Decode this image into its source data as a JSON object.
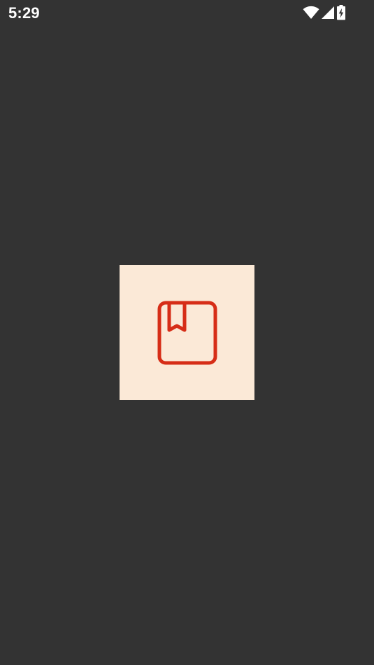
{
  "status_bar": {
    "time": "5:29",
    "icons": [
      "wifi-icon",
      "cell-signal-icon",
      "battery-charging-icon"
    ],
    "icon_color": "#ffffff"
  },
  "splash": {
    "background_color": "#fbe9d7",
    "icon": "book-bookmark-icon",
    "icon_color": "#d62d17"
  },
  "screen_background": "#333333"
}
